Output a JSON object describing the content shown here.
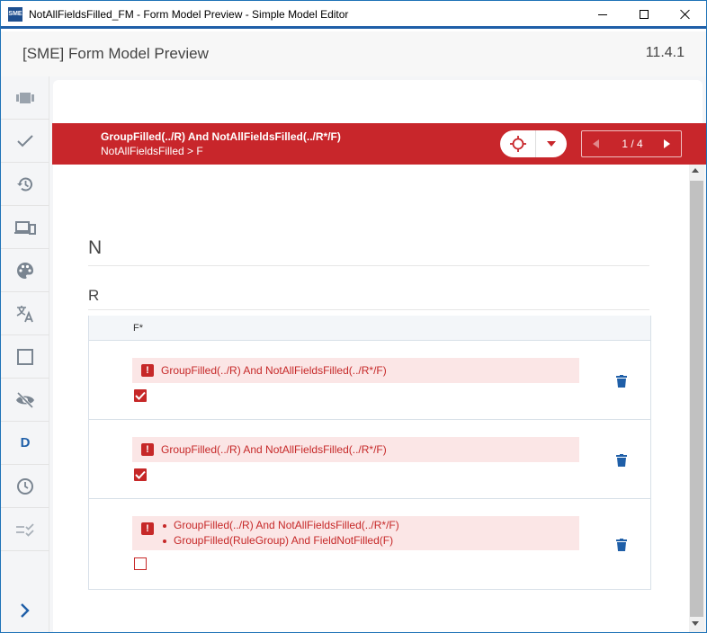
{
  "window": {
    "title": "NotAllFieldsFilled_FM - Form Model Preview - Simple Model Editor",
    "icon_text": "SME"
  },
  "header": {
    "title": "[SME] Form Model Preview",
    "version": "11.4.1"
  },
  "sidebar": {
    "items": [
      {
        "icon": "model-icon"
      },
      {
        "icon": "checkmark-icon"
      },
      {
        "icon": "history-icon"
      },
      {
        "icon": "devices-icon"
      },
      {
        "icon": "palette-icon"
      },
      {
        "icon": "translate-icon"
      },
      {
        "icon": "square-icon"
      },
      {
        "icon": "eye-off-icon"
      },
      {
        "label": "D"
      },
      {
        "icon": "clock-icon"
      },
      {
        "icon": "checklist-icon"
      }
    ],
    "expand_icon": "chevron-right-icon"
  },
  "banner": {
    "title": "GroupFilled(../R) And NotAllFieldsFilled(../R*/F)",
    "subtitle": "NotAllFieldsFilled > F",
    "pager": "1 / 4",
    "background": "#c8262b"
  },
  "form": {
    "section_n": "N",
    "section_r": "R",
    "column_header": "F*",
    "rows": [
      {
        "error": "GroupFilled(../R) And NotAllFieldsFilled(../R*/F)",
        "checked": true
      },
      {
        "error": "GroupFilled(../R) And NotAllFieldsFilled(../R*/F)",
        "checked": true
      },
      {
        "errors": [
          "GroupFilled(../R) And NotAllFieldsFilled(../R*/F)",
          "GroupFilled(RuleGroup) And FieldNotFilled(F)"
        ],
        "checked": false
      }
    ]
  },
  "colors": {
    "accent": "#1f5fa8",
    "error": "#c62828",
    "error_bg": "#fbe6e6"
  }
}
